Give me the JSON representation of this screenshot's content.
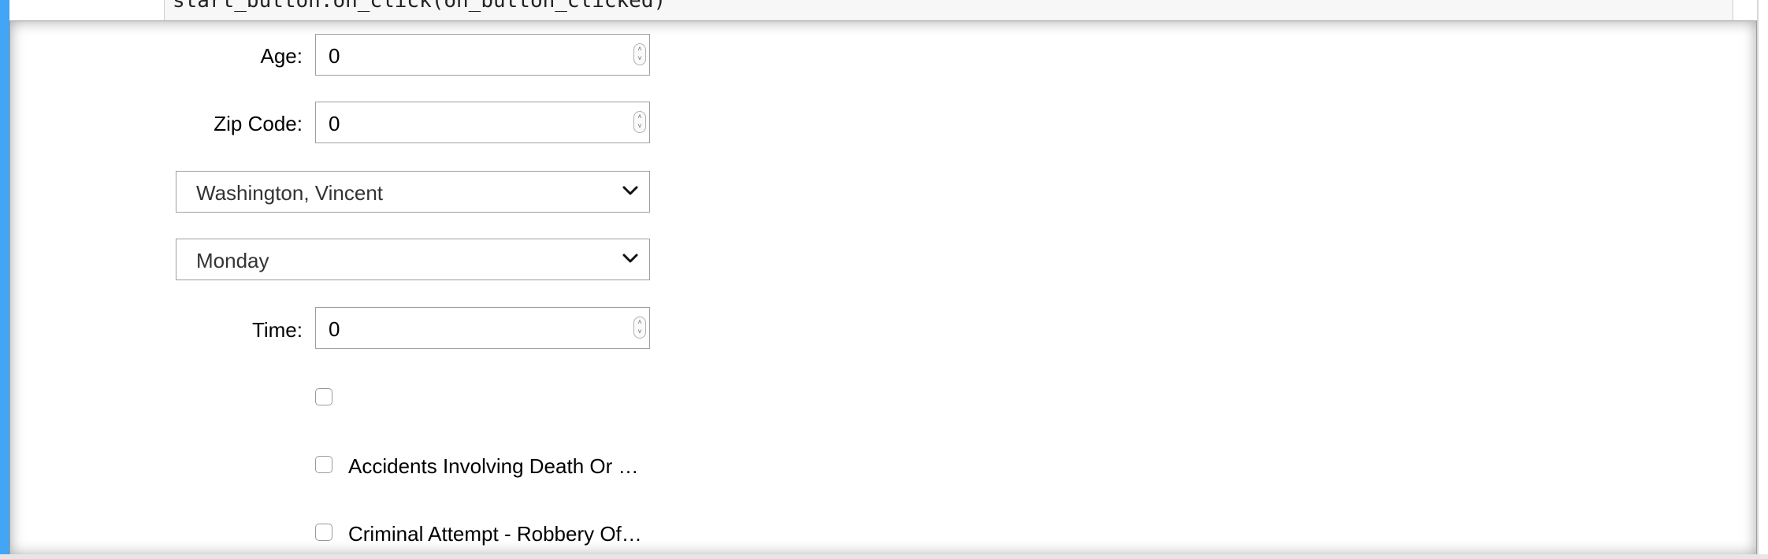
{
  "code_cell": {
    "partial_line": "start_button.on_click(on_button_clicked)"
  },
  "form": {
    "age": {
      "label": "Age:",
      "value": "0"
    },
    "zip": {
      "label": "Zip Code:",
      "value": "0"
    },
    "officer_select": {
      "selected": "Washington, Vincent"
    },
    "day_select": {
      "selected": "Monday"
    },
    "time": {
      "label": "Time:",
      "value": "0"
    },
    "checkboxes": [
      {
        "label": "",
        "checked": false
      },
      {
        "label": "Accidents Involving Death Or …",
        "checked": false
      },
      {
        "label": "Criminal Attempt - Robbery Of…",
        "checked": false
      }
    ]
  },
  "colors": {
    "accent": "#42a5f5",
    "border": "#9e9e9e"
  }
}
